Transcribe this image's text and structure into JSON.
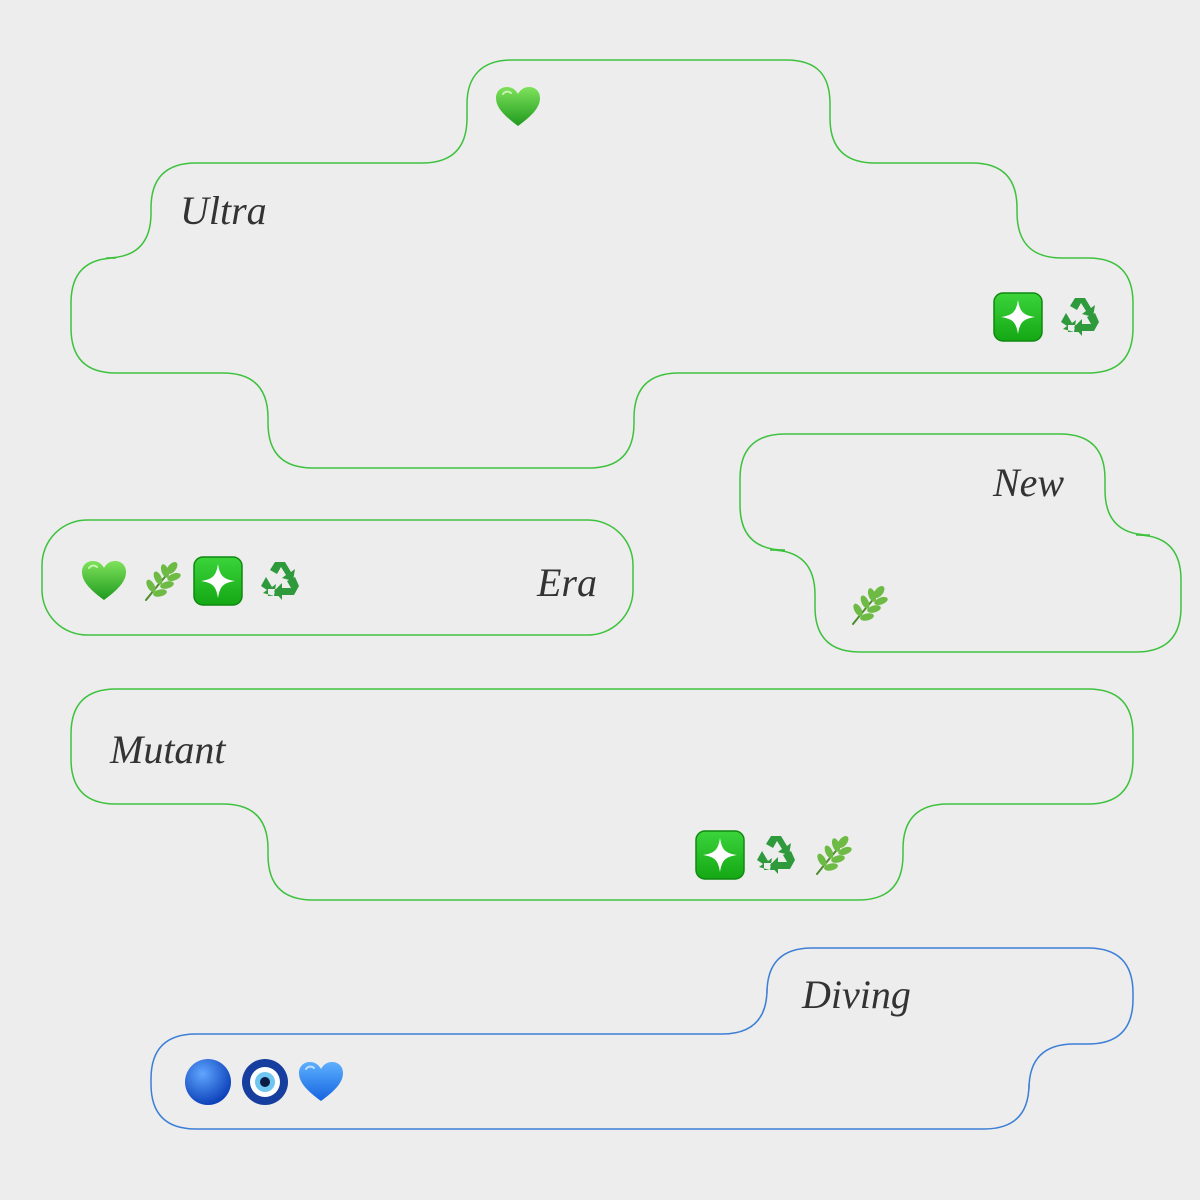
{
  "colors": {
    "background": "#ededed",
    "green_outline": "#3ec23e",
    "blue_outline": "#3c7fd6",
    "text": "#333333"
  },
  "shapes": [
    {
      "label": "Ultra",
      "icons": [
        "green-heart-icon",
        "sparkle-button-icon",
        "recycle-icon"
      ]
    },
    {
      "label": "New",
      "icons": [
        "herb-icon"
      ]
    },
    {
      "label": "Era",
      "icons": [
        "green-heart-icon",
        "herb-icon",
        "sparkle-button-icon",
        "recycle-icon"
      ]
    },
    {
      "label": "Mutant",
      "icons": [
        "sparkle-button-icon",
        "recycle-icon",
        "herb-icon"
      ]
    },
    {
      "label": "Diving",
      "icons": [
        "blue-circle-icon",
        "nazar-amulet-icon",
        "blue-heart-icon"
      ]
    }
  ]
}
